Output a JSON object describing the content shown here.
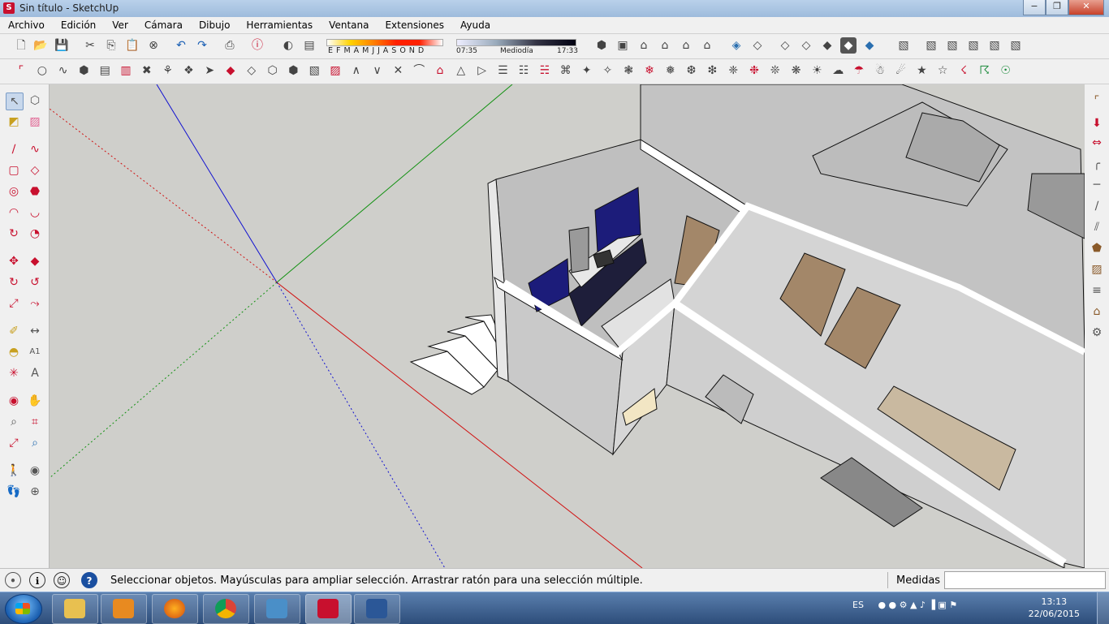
{
  "window": {
    "title": "Sin título - SketchUp"
  },
  "menubar": {
    "items": [
      "Archivo",
      "Edición",
      "Ver",
      "Cámara",
      "Dibujo",
      "Herramientas",
      "Ventana",
      "Extensiones",
      "Ayuda"
    ]
  },
  "shadow": {
    "months": "EFMAMJJASOND",
    "time_start": "07:35",
    "time_mid": "Mediodía",
    "time_end": "17:33"
  },
  "statusbar": {
    "message": "Seleccionar objetos. Mayúsculas para ampliar selección. Arrastrar ratón para una selección múltiple.",
    "measurements_label": "Medidas",
    "measurements_value": ""
  },
  "taskbar": {
    "language": "ES",
    "time": "13:13",
    "date": "22/06/2015",
    "apps": [
      "explorer-icon",
      "media-player-icon",
      "firefox-icon",
      "chrome-icon",
      "photo-viewer-icon",
      "sketchup-icon",
      "word-icon"
    ]
  },
  "colors": {
    "viewport": "#cfcfcb",
    "axis_red": "#d01010",
    "axis_green": "#109010",
    "axis_blue": "#1010d0",
    "cabinet_blue": "#1c1c7a",
    "door_brown": "#a38769"
  }
}
